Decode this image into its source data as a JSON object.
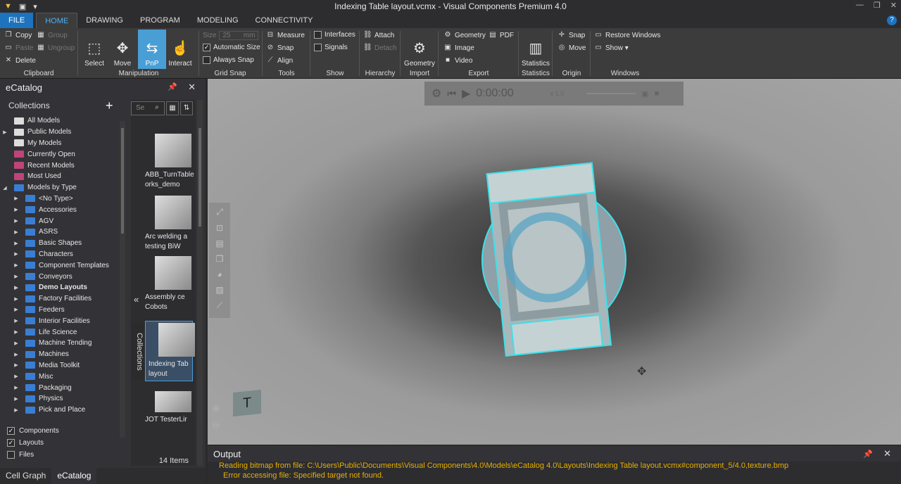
{
  "window": {
    "title": "Indexing Table layout.vcmx - Visual Components Premium 4.0"
  },
  "tabs": [
    "FILE",
    "HOME",
    "DRAWING",
    "PROGRAM",
    "MODELING",
    "CONNECTIVITY"
  ],
  "ribbon": {
    "clipboard": {
      "copy": "Copy",
      "paste": "Paste",
      "delete": "Delete",
      "label": "Clipboard"
    },
    "group": {
      "group": "Group",
      "ungroup": "Ungroup"
    },
    "manipulation": {
      "select": "Select",
      "move": "Move",
      "pnp": "PnP",
      "interact": "Interact",
      "label": "Manipulation"
    },
    "gridsnap": {
      "size_label": "Size",
      "size_value": "25",
      "size_unit": "mm",
      "auto": "Automatic Size",
      "always": "Always Snap",
      "label": "Grid Snap"
    },
    "tools": {
      "measure": "Measure",
      "snap": "Snap",
      "align": "Align",
      "label": "Tools"
    },
    "show": {
      "interfaces": "Interfaces",
      "signals": "Signals",
      "label": "Show"
    },
    "hierarchy": {
      "attach": "Attach",
      "detach": "Detach",
      "label": "Hierarchy"
    },
    "import": {
      "geometry": "Geometry",
      "label": "Import"
    },
    "export": {
      "geometry": "Geometry",
      "pdf": "PDF",
      "image": "Image",
      "video": "Video",
      "label": "Export"
    },
    "statistics": {
      "statistics": "Statistics",
      "label": "Statistics"
    },
    "origin": {
      "snap": "Snap",
      "move": "Move",
      "label": "Origin"
    },
    "windows": {
      "restore": "Restore Windows",
      "show": "Show ▾",
      "label": "Windows"
    }
  },
  "ecatalog": {
    "title": "eCatalog",
    "collections_label": "Collections",
    "tree": [
      {
        "label": "All Models",
        "color": "#dddddd",
        "arrow": ""
      },
      {
        "label": "Public Models",
        "color": "#dddddd",
        "arrow": "▶"
      },
      {
        "label": "My Models",
        "color": "#dddddd",
        "arrow": ""
      },
      {
        "label": "Currently Open",
        "color": "#c0447a",
        "arrow": ""
      },
      {
        "label": "Recent Models",
        "color": "#c0447a",
        "arrow": ""
      },
      {
        "label": "Most Used",
        "color": "#c0447a",
        "arrow": ""
      },
      {
        "label": "Models by Type",
        "color": "#3a7ed4",
        "arrow": "◢"
      },
      {
        "label": "<No Type>",
        "color": "#3a7ed4",
        "arrow": "▶",
        "indent": 1
      },
      {
        "label": "Accessories",
        "color": "#3a7ed4",
        "arrow": "▶",
        "indent": 1
      },
      {
        "label": "AGV",
        "color": "#3a7ed4",
        "arrow": "▶",
        "indent": 1
      },
      {
        "label": "ASRS",
        "color": "#3a7ed4",
        "arrow": "▶",
        "indent": 1
      },
      {
        "label": "Basic Shapes",
        "color": "#3a7ed4",
        "arrow": "▶",
        "indent": 1
      },
      {
        "label": "Characters",
        "color": "#3a7ed4",
        "arrow": "▶",
        "indent": 1
      },
      {
        "label": "Component Templates",
        "color": "#3a7ed4",
        "arrow": "▶",
        "indent": 1
      },
      {
        "label": "Conveyors",
        "color": "#3a7ed4",
        "arrow": "▶",
        "indent": 1
      },
      {
        "label": "Demo Layouts",
        "color": "#3a7ed4",
        "arrow": "▶",
        "indent": 1,
        "bold": true
      },
      {
        "label": "Factory Facilities",
        "color": "#3a7ed4",
        "arrow": "▶",
        "indent": 1
      },
      {
        "label": "Feeders",
        "color": "#3a7ed4",
        "arrow": "▶",
        "indent": 1
      },
      {
        "label": "Interior Facilities",
        "color": "#3a7ed4",
        "arrow": "▶",
        "indent": 1
      },
      {
        "label": "Life Science",
        "color": "#3a7ed4",
        "arrow": "▶",
        "indent": 1
      },
      {
        "label": "Machine Tending",
        "color": "#3a7ed4",
        "arrow": "▶",
        "indent": 1
      },
      {
        "label": "Machines",
        "color": "#3a7ed4",
        "arrow": "▶",
        "indent": 1
      },
      {
        "label": "Media Toolkit",
        "color": "#3a7ed4",
        "arrow": "▶",
        "indent": 1
      },
      {
        "label": "Misc",
        "color": "#3a7ed4",
        "arrow": "▶",
        "indent": 1
      },
      {
        "label": "Packaging",
        "color": "#3a7ed4",
        "arrow": "▶",
        "indent": 1
      },
      {
        "label": "Physics",
        "color": "#3a7ed4",
        "arrow": "▶",
        "indent": 1
      },
      {
        "label": "Pick and Place",
        "color": "#3a7ed4",
        "arrow": "▶",
        "indent": 1
      }
    ],
    "filters": [
      {
        "label": "Components",
        "checked": true
      },
      {
        "label": "Layouts",
        "checked": true
      },
      {
        "label": "Files",
        "checked": false
      }
    ],
    "search_placeholder": "Se",
    "items": [
      {
        "name": "ABB_TurnTable\norks_demo"
      },
      {
        "name": "Arc welding a\ntesting BiW"
      },
      {
        "name": "Assembly ce\nCobots"
      },
      {
        "name": "Indexing Tab\nlayout"
      },
      {
        "name": "JOT TesterLir"
      }
    ],
    "vertical_tab": "Collections",
    "count": "14 Items"
  },
  "bottom_tabs": [
    "Cell Graph",
    "eCatalog"
  ],
  "animation": {
    "time": "0:00:00",
    "speed": "x 1.0"
  },
  "viewcube_label": "T",
  "output": {
    "title": "Output",
    "lines": [
      "Reading bitmap from file: C:\\Users\\Public\\Documents\\Visual Components\\4.0\\Models\\eCatalog 4.0\\Layouts\\Indexing Table layout.vcmx#component_5/4.0,texture.bmp",
      "Error accessing file: Specified target not found."
    ]
  }
}
